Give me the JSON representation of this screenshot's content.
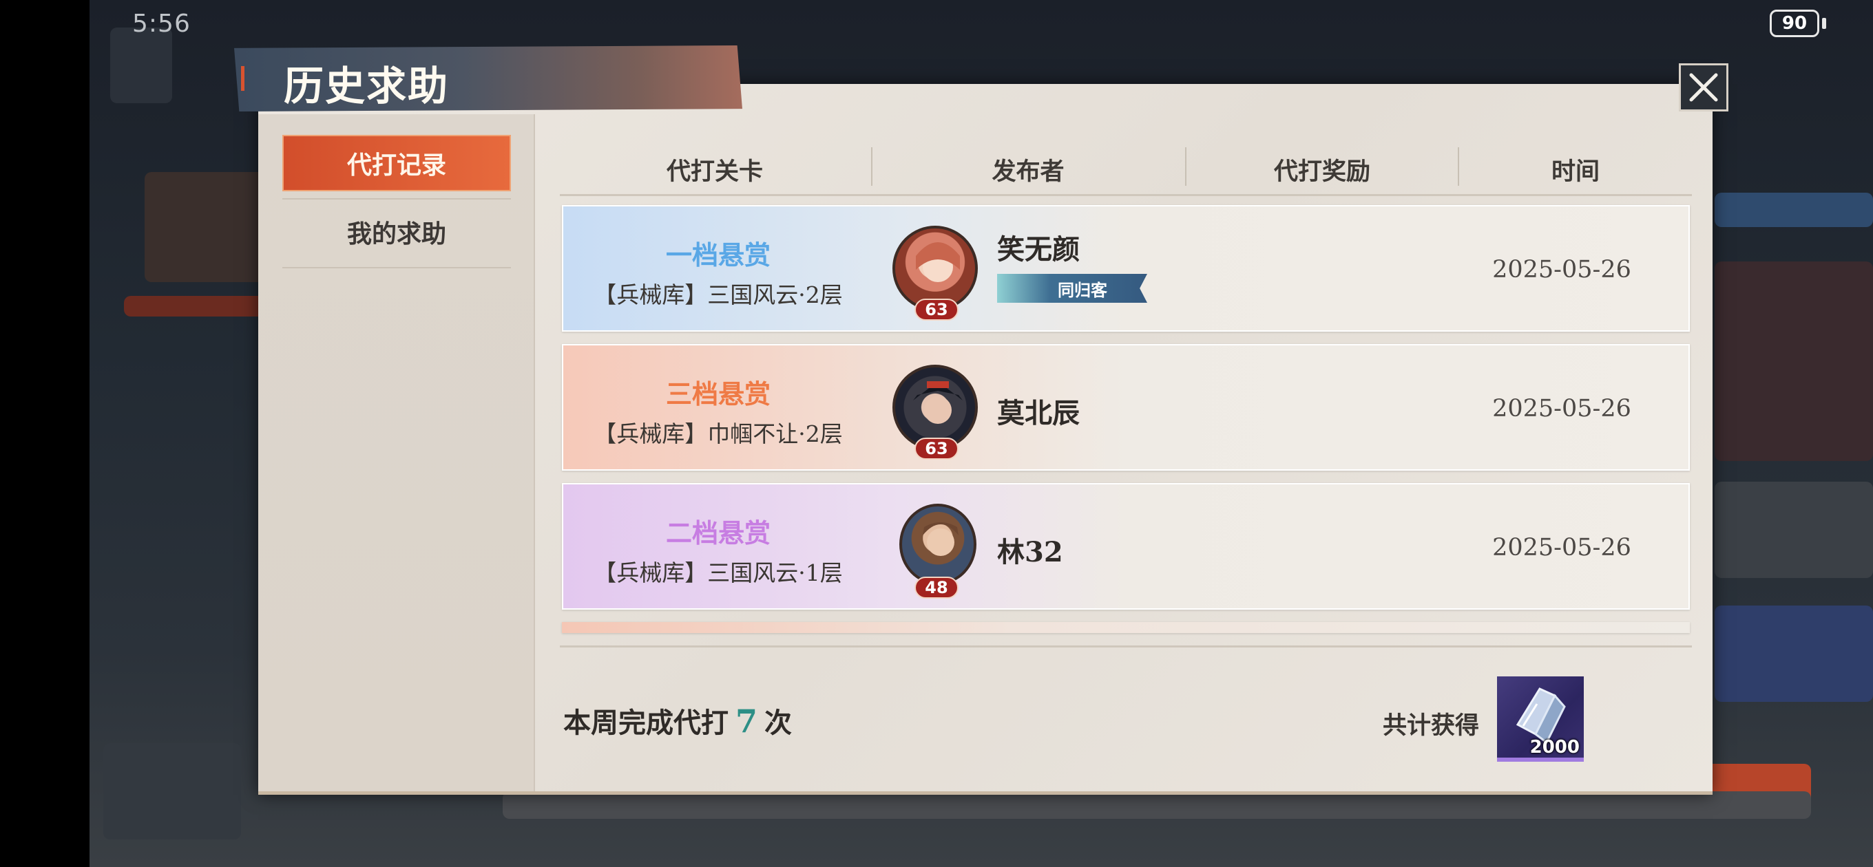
{
  "status_bar": {
    "time": "5:56",
    "battery": "90"
  },
  "dialog": {
    "title": "历史求助",
    "close_icon": "close-x-icon"
  },
  "sidebar": {
    "items": [
      {
        "label": "代打记录",
        "active": true
      },
      {
        "label": "我的求助",
        "active": false
      }
    ]
  },
  "table": {
    "headers": [
      "代打关卡",
      "发布者",
      "代打奖励",
      "时间"
    ],
    "rows": [
      {
        "tier": "一档悬赏",
        "tier_color": "#59a7e6",
        "stage": "【兵械库】三国风云·2层",
        "publisher": "笑无颜",
        "level": "63",
        "badge": "同归客",
        "reward": "",
        "date": "2025-05-26"
      },
      {
        "tier": "三档悬赏",
        "tier_color": "#ef7a45",
        "stage": "【兵械库】巾帼不让·2层",
        "publisher": "莫北辰",
        "level": "63",
        "badge": "",
        "reward": "",
        "date": "2025-05-26"
      },
      {
        "tier": "二档悬赏",
        "tier_color": "#c77de2",
        "stage": "【兵械库】三国风云·1层",
        "publisher": "林32",
        "level": "48",
        "badge": "",
        "reward": "",
        "date": "2025-05-26"
      }
    ]
  },
  "footer": {
    "weekly_prefix": "本周完成代打",
    "weekly_count": "7",
    "weekly_suffix": "次",
    "total_label": "共计获得",
    "reward_count": "2000",
    "reward_icon": "crystal-item-icon"
  }
}
